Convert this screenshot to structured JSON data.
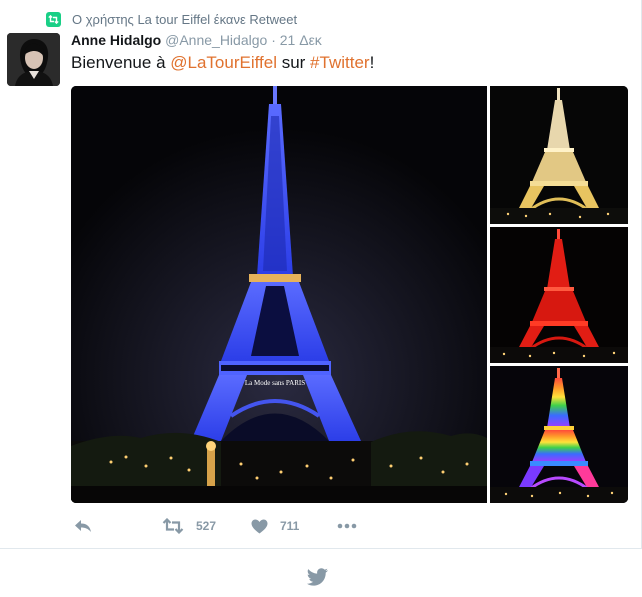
{
  "retweet_context": {
    "text": "Ο χρήστης La tour Eiffel έκανε Retweet",
    "icon": "retweet-icon"
  },
  "tweet": {
    "author_name": "Anne Hidalgo",
    "author_handle": "@Anne_Hidalgo",
    "separator": "·",
    "time": "21 Δεκ",
    "text_before": "Bienvenue à ",
    "mention": "@LaTourEiffel",
    "text_middle": " sur ",
    "hashtag": "#Twitter",
    "text_after": "!",
    "media": [
      {
        "name": "eiffel-blue-photo",
        "caption": "La Mode sans PARIS"
      },
      {
        "name": "eiffel-gold-photo"
      },
      {
        "name": "eiffel-red-photo"
      },
      {
        "name": "eiffel-rainbow-photo"
      }
    ],
    "actions": {
      "reply_icon": "reply-icon",
      "retweet_icon": "retweet-icon",
      "retweet_count": "527",
      "like_icon": "heart-icon",
      "like_count": "711",
      "more_icon": "more-icon"
    }
  },
  "colors": {
    "link": "#e0722f",
    "retweet_badge": "#19cf86",
    "muted": "#8899a6",
    "border": "#e1e8ed"
  },
  "footer": {
    "icon": "twitter-bird-icon"
  }
}
